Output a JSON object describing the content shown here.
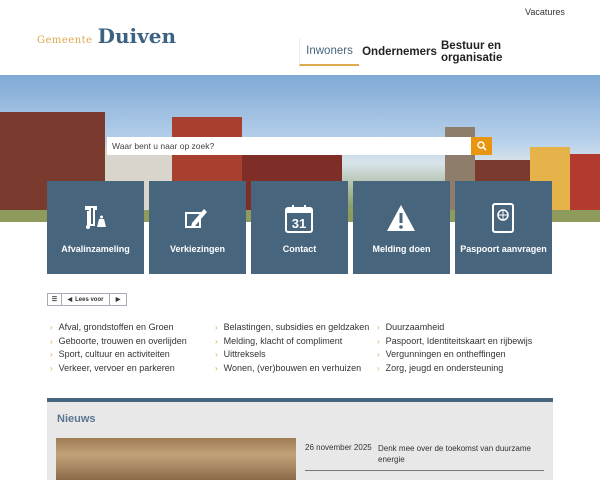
{
  "header": {
    "vacatures": "Vacatures",
    "logo_prefix": "Gemeente",
    "logo_name": "Duiven",
    "nav": [
      {
        "label": "Inwoners",
        "active": true
      },
      {
        "label": "Ondernemers"
      },
      {
        "label": "Bestuur en organisatie"
      }
    ]
  },
  "search": {
    "placeholder": "Waar bent u naar op zoek?"
  },
  "tiles": [
    {
      "label": "Afvalinzameling",
      "icon": "waste-bin-icon"
    },
    {
      "label": "Verkiezingen",
      "icon": "ballot-pen-icon"
    },
    {
      "label": "Contact",
      "icon": "calendar-icon",
      "icon_text": "31"
    },
    {
      "label": "Melding doen",
      "icon": "warning-icon"
    },
    {
      "label": "Paspoort aanvragen",
      "icon": "passport-icon"
    }
  ],
  "readspeaker": {
    "label": "Lees voor"
  },
  "links": [
    [
      "Afval, grondstoffen en Groen",
      "Geboorte, trouwen en overlijden",
      "Sport, cultuur en activiteiten",
      "Verkeer, vervoer en parkeren"
    ],
    [
      "Belastingen, subsidies en geldzaken",
      "Melding, klacht of compliment",
      "Uittreksels",
      "Wonen, (ver)bouwen en verhuizen"
    ],
    [
      "Duurzaamheid",
      "Paspoort, Identiteitskaart en rijbewijs",
      "Vergunningen en ontheffingen",
      "Zorg, jeugd en ondersteuning"
    ]
  ],
  "news": {
    "title": "Nieuws",
    "items": [
      {
        "date": "26 november 2025",
        "title": "Denk mee over de toekomst van duurzame energie"
      }
    ]
  },
  "colors": {
    "tile": "#48657e",
    "accent": "#e0a850",
    "search_button": "#e8960f"
  }
}
